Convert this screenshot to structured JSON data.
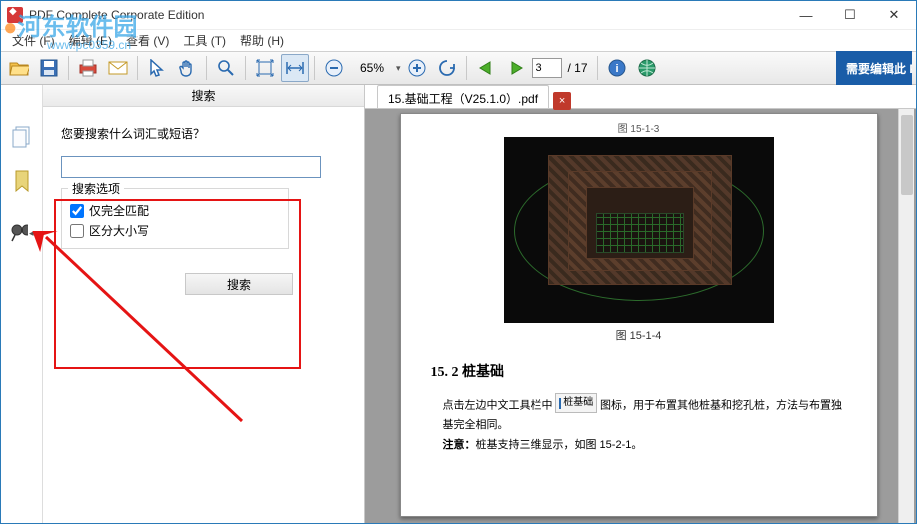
{
  "window": {
    "title": "PDF Complete Corporate Edition",
    "watermark_main": "河东软件园",
    "watermark_url": "www.pc0359.cn"
  },
  "menu": {
    "file": "文件 (F)",
    "edit": "编辑 (E)",
    "view": "查看 (V)",
    "tools": "工具 (T)",
    "help": "帮助 (H)"
  },
  "toolbar": {
    "zoom_value": "65%",
    "dd": "▾",
    "page_current": "3",
    "page_total": "/ 17",
    "banner": "需要编辑此 P"
  },
  "search": {
    "panel_title": "搜索",
    "prompt": "您要搜索什么词汇或短语？",
    "input_value": "",
    "options_legend": "搜索选项",
    "opt_whole": "仅完全匹配",
    "opt_case": "区分大小写",
    "btn": "搜索"
  },
  "tab": {
    "label": "15.基础工程（V25.1.0）.pdf",
    "close": "×"
  },
  "doc": {
    "top_fig": "图 15-1-3",
    "fig_caption": "图 15-1-4",
    "section": "15. 2 桩基础",
    "p1a": "点击左边中文工具栏中",
    "p1_btn": "桩基础",
    "p1b": "图标，用于布置其他桩基和挖孔桩，方法与布置独基完全相同。",
    "p2a": "注意：",
    "p2b": "桩基支持三维显示，如图 15-2-1。"
  }
}
